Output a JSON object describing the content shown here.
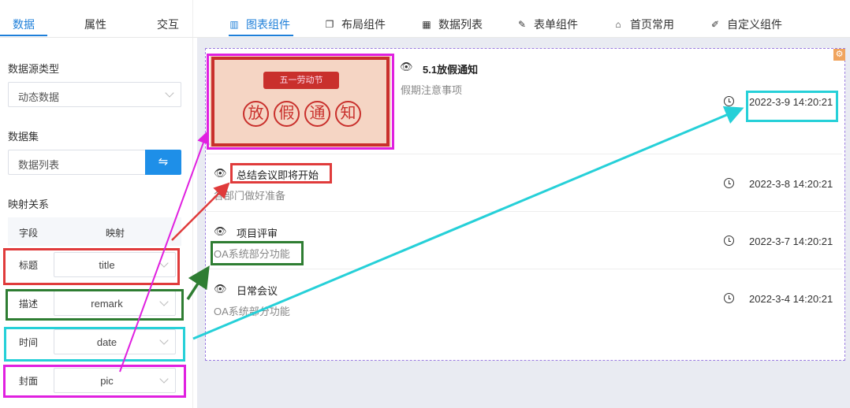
{
  "left_tabs": [
    "数据",
    "属性",
    "交互"
  ],
  "datasource_type": {
    "label": "数据源类型",
    "value": "动态数据"
  },
  "dataset": {
    "label": "数据集",
    "value": "数据列表",
    "swap_icon": "swap-icon"
  },
  "mapping": {
    "label": "映射关系",
    "col_field": "字段",
    "col_map": "映射",
    "rows": [
      {
        "field": "标题",
        "value": "title"
      },
      {
        "field": "描述",
        "value": "remark"
      },
      {
        "field": "时间",
        "value": "date"
      },
      {
        "field": "封面",
        "value": "pic"
      }
    ]
  },
  "top_tabs": [
    {
      "label": "图表组件",
      "icon": "chart-icon"
    },
    {
      "label": "布局组件",
      "icon": "layout-icon"
    },
    {
      "label": "数据列表",
      "icon": "table-icon"
    },
    {
      "label": "表单组件",
      "icon": "edit-icon"
    },
    {
      "label": "首页常用",
      "icon": "home-icon"
    },
    {
      "label": "自定义组件",
      "icon": "file-edit-icon"
    }
  ],
  "cover_banner": {
    "ribbon": "五一劳动节",
    "chars": [
      "放",
      "假",
      "通",
      "知"
    ]
  },
  "list": [
    {
      "title": "5.1放假通知",
      "desc": "假期注意事项",
      "time": "2022-3-9 14:20:21"
    },
    {
      "title": "总结会议即将开始",
      "desc": "各部门做好准备",
      "time": "2022-3-8 14:20:21"
    },
    {
      "title": "项目评审",
      "desc": "OA系统部分功能",
      "time": "2022-3-7 14:20:21"
    },
    {
      "title": "日常会议",
      "desc": "OA系统部分功能",
      "time": "2022-3-4 14:20:21"
    }
  ],
  "colors": {
    "accent": "#1e7fd9",
    "anno_red": "#e03b3b",
    "anno_green": "#2e7d32",
    "anno_cyan": "#26d0d8",
    "anno_magenta": "#e020e0"
  }
}
